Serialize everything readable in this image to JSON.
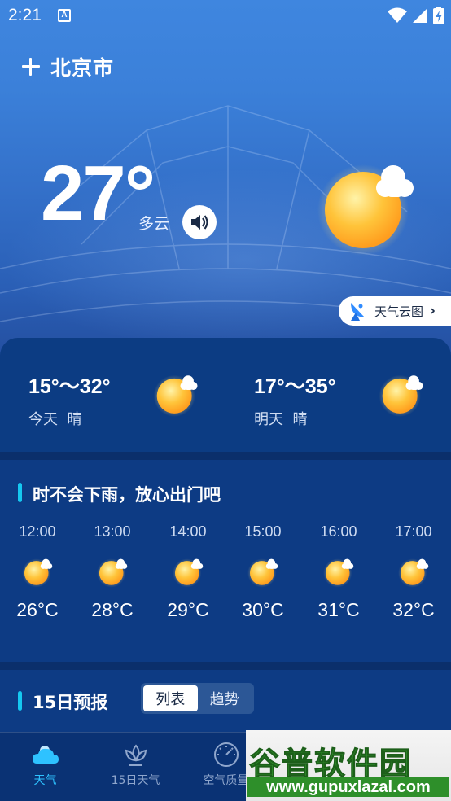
{
  "status_bar": {
    "time": "2:21",
    "notif_glyph": "A",
    "icons": [
      "wifi-icon",
      "signal-icon",
      "battery-charging-icon"
    ]
  },
  "header": {
    "city": "北京市"
  },
  "current": {
    "temperature": "27°",
    "condition": "多云",
    "sun_icon": "sun-cloud-icon"
  },
  "cloud_map_button": {
    "label": "天气云图"
  },
  "days": [
    {
      "range": "15°～32°",
      "label": "今天  晴"
    },
    {
      "range": "17°～35°",
      "label": "明天  晴"
    }
  ],
  "hourly": {
    "title": "时不会下雨，放心出门吧",
    "items": [
      {
        "time": "12:00",
        "temp": "26°C"
      },
      {
        "time": "13:00",
        "temp": "28°C"
      },
      {
        "time": "14:00",
        "temp": "29°C"
      },
      {
        "time": "15:00",
        "temp": "30°C"
      },
      {
        "time": "16:00",
        "temp": "31°C"
      },
      {
        "time": "17:00",
        "temp": "32°C"
      }
    ]
  },
  "forecast": {
    "title": "15日预报",
    "tabs": [
      "列表",
      "趋势"
    ],
    "active_tab": "列表"
  },
  "bottom_nav": [
    {
      "label": "天气",
      "icon": "cloud-icon",
      "active": true
    },
    {
      "label": "15日天气",
      "icon": "lotus-icon",
      "active": false
    },
    {
      "label": "空气质量",
      "icon": "gauge-icon",
      "active": false
    }
  ],
  "watermark": {
    "title": "谷普软件园",
    "url": "www.gupuxlazal.com"
  },
  "colors": {
    "accent": "#15c8f0",
    "nav_active": "#2ec2ff",
    "panel": "#0c3c83",
    "sun": "#ffb42a"
  }
}
